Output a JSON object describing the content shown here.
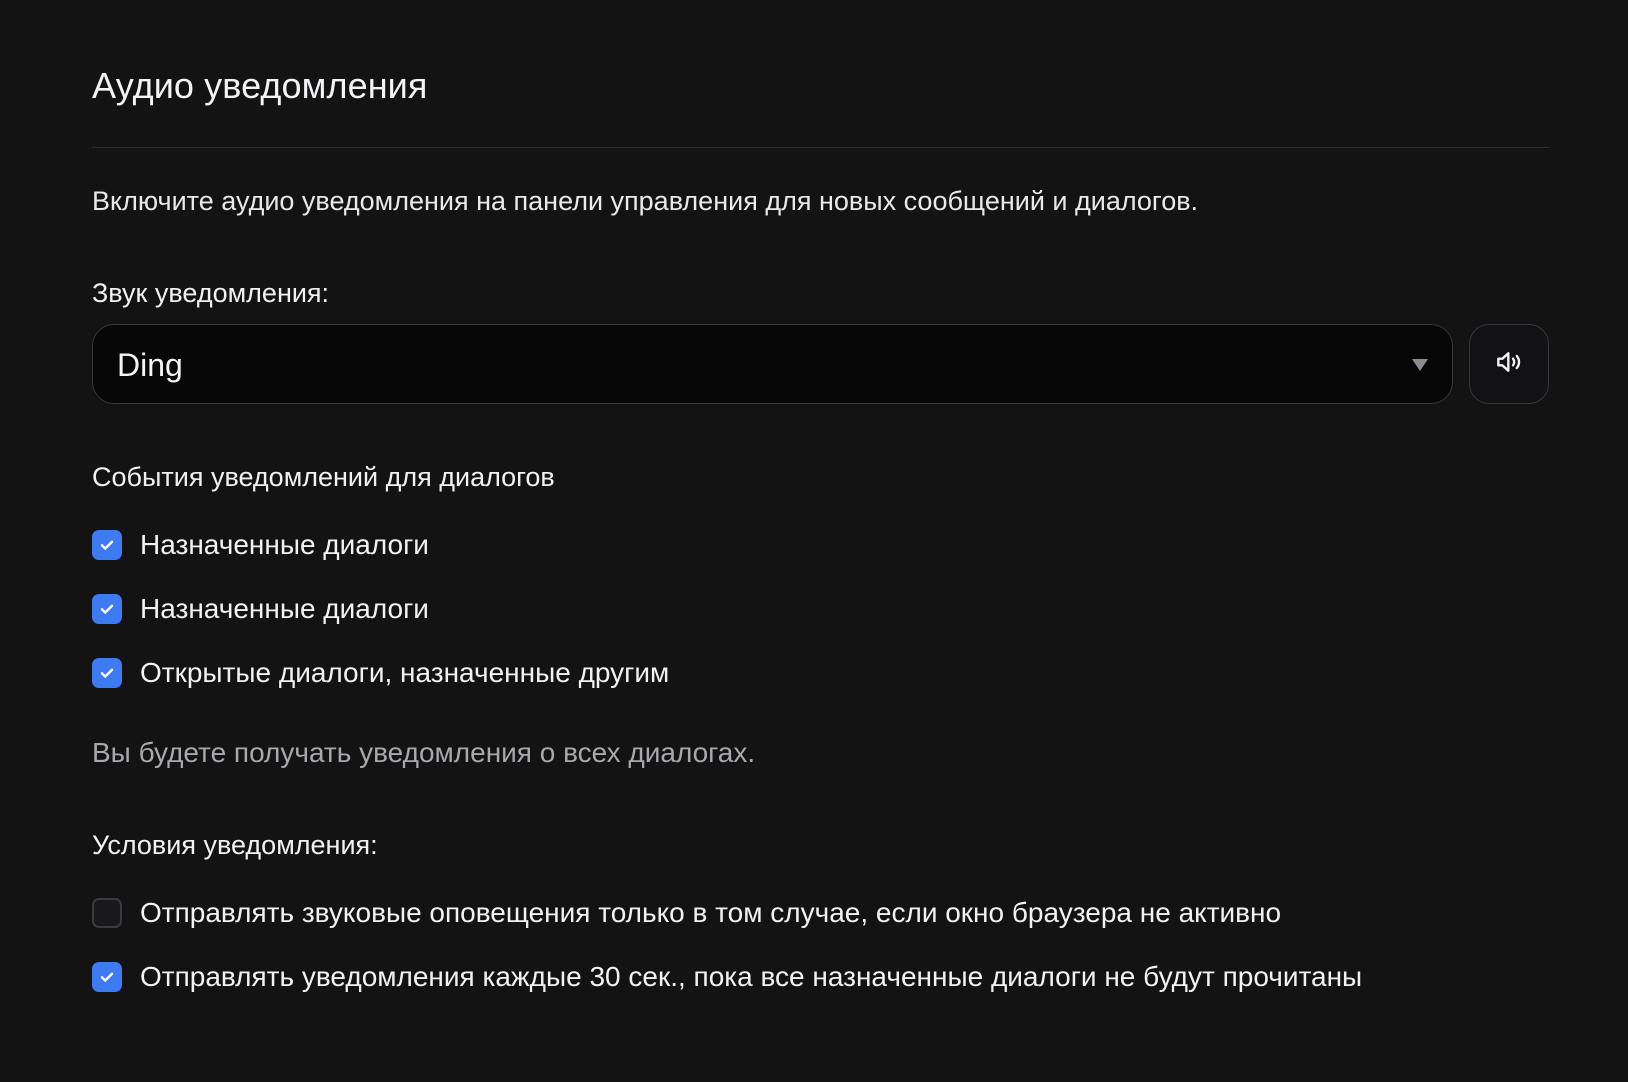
{
  "section": {
    "title": "Аудио уведомления",
    "description": "Включите аудио уведомления на панели управления для новых сообщений и диалогов."
  },
  "sound": {
    "label": "Звук уведомления:",
    "selected": "Ding",
    "play_icon": "speaker-icon"
  },
  "events": {
    "label": "События уведомлений для диалогов",
    "items": [
      {
        "label": "Назначенные диалоги",
        "checked": true
      },
      {
        "label": "Назначенные диалоги",
        "checked": true
      },
      {
        "label": "Открытые диалоги, назначенные другим",
        "checked": true
      }
    ],
    "hint": "Вы будете получать уведомления о всех диалогах."
  },
  "conditions": {
    "label": "Условия уведомления:",
    "items": [
      {
        "label": "Отправлять звуковые оповещения только в том случае, если окно браузера не активно",
        "checked": false
      },
      {
        "label": "Отправлять уведомления каждые 30 сек., пока все назначенные диалоги не будут прочитаны",
        "checked": true
      }
    ]
  },
  "colors": {
    "background": "#131314",
    "checkbox_active": "#3e7bf3",
    "border": "#37373c"
  }
}
